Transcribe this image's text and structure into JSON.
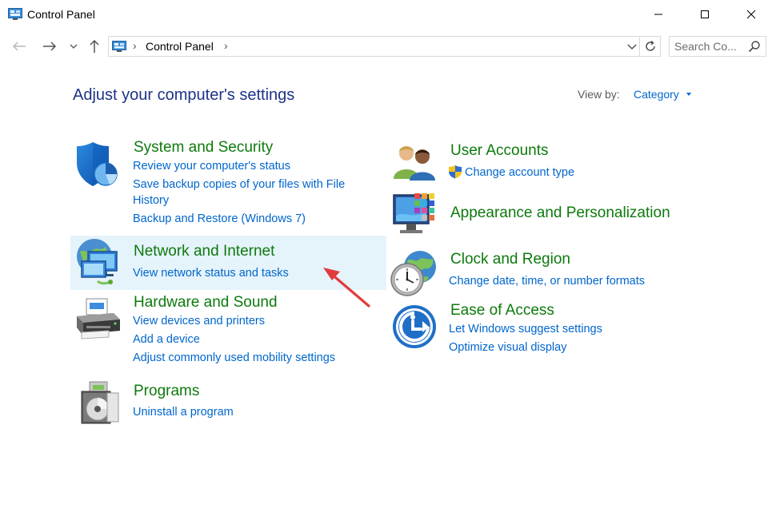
{
  "window": {
    "title": "Control Panel"
  },
  "navigation": {
    "breadcrumb": "Control Panel",
    "search_placeholder": "Search Co..."
  },
  "content": {
    "heading": "Adjust your computer's settings",
    "view_by_label": "View by:",
    "view_by_value": "Category"
  },
  "categories": {
    "system_security": {
      "title": "System and Security",
      "links": [
        "Review your computer's status",
        "Save backup copies of your files with File",
        "History",
        "Backup and Restore (Windows 7)"
      ]
    },
    "network_internet": {
      "title": "Network and Internet",
      "links": [
        "View network status and tasks"
      ]
    },
    "hardware_sound": {
      "title": "Hardware and Sound",
      "links": [
        "View devices and printers",
        "Add a device",
        "Adjust commonly used mobility settings"
      ]
    },
    "programs": {
      "title": "Programs",
      "links": [
        "Uninstall a program"
      ]
    },
    "user_accounts": {
      "title": "User Accounts",
      "links": [
        "Change account type"
      ]
    },
    "appearance": {
      "title": "Appearance and Personalization"
    },
    "clock_region": {
      "title": "Clock and Region",
      "links": [
        "Change date, time, or number formats"
      ]
    },
    "ease_access": {
      "title": "Ease of Access",
      "links": [
        "Let Windows suggest settings",
        "Optimize visual display"
      ]
    }
  },
  "colors": {
    "heading_blue": "#1e3287",
    "category_green": "#0d7a0d",
    "link_blue": "#0066cc",
    "highlight": "#e5f3fb",
    "annotation_red": "#e03c3c"
  },
  "icons": [
    "control-panel-icon",
    "minimize-icon",
    "maximize-icon",
    "close-icon",
    "back-arrow-icon",
    "forward-arrow-icon",
    "chevron-down-icon",
    "up-arrow-icon",
    "refresh-icon",
    "search-icon",
    "shield-icon",
    "network-globe-icon",
    "printer-icon",
    "programs-disc-icon",
    "users-icon",
    "uac-shield-icon",
    "monitor-palette-icon",
    "clock-globe-icon",
    "ease-of-access-icon",
    "red-arrow-annotation"
  ]
}
